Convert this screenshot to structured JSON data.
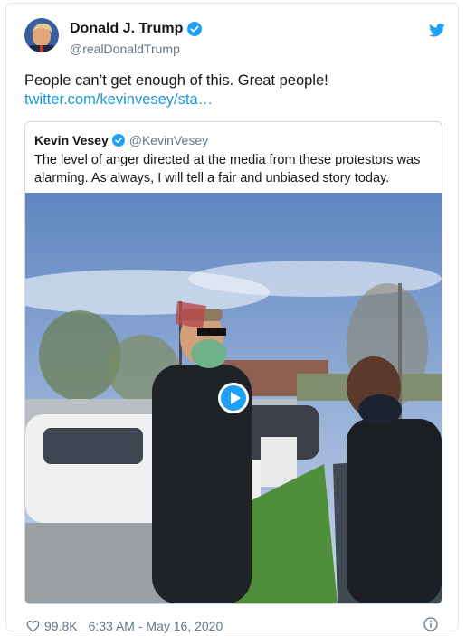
{
  "author": {
    "display_name": "Donald J. Trump",
    "handle": "@realDonaldTrump",
    "verified": true
  },
  "tweet": {
    "text": "People can’t get enough of this. Great people!",
    "link": "twitter.com/kevinvesey/sta…"
  },
  "quoted": {
    "display_name": "Kevin Vesey",
    "handle": "@KevinVesey",
    "verified": true,
    "text": "The level of anger directed at the media from these protestors was alarming. As always, I will tell a fair and unbiased story today."
  },
  "footer": {
    "likes": "99.8K",
    "timestamp": "6:33 AM - May 16, 2020"
  },
  "icons": {
    "brand": "twitter-bird-icon",
    "verified": "verified-badge-icon",
    "like": "heart-icon",
    "info": "info-icon",
    "play": "play-icon"
  },
  "colors": {
    "twitter_blue": "#1da1f2",
    "link": "#1b95e0",
    "secondary_text": "#657786"
  }
}
